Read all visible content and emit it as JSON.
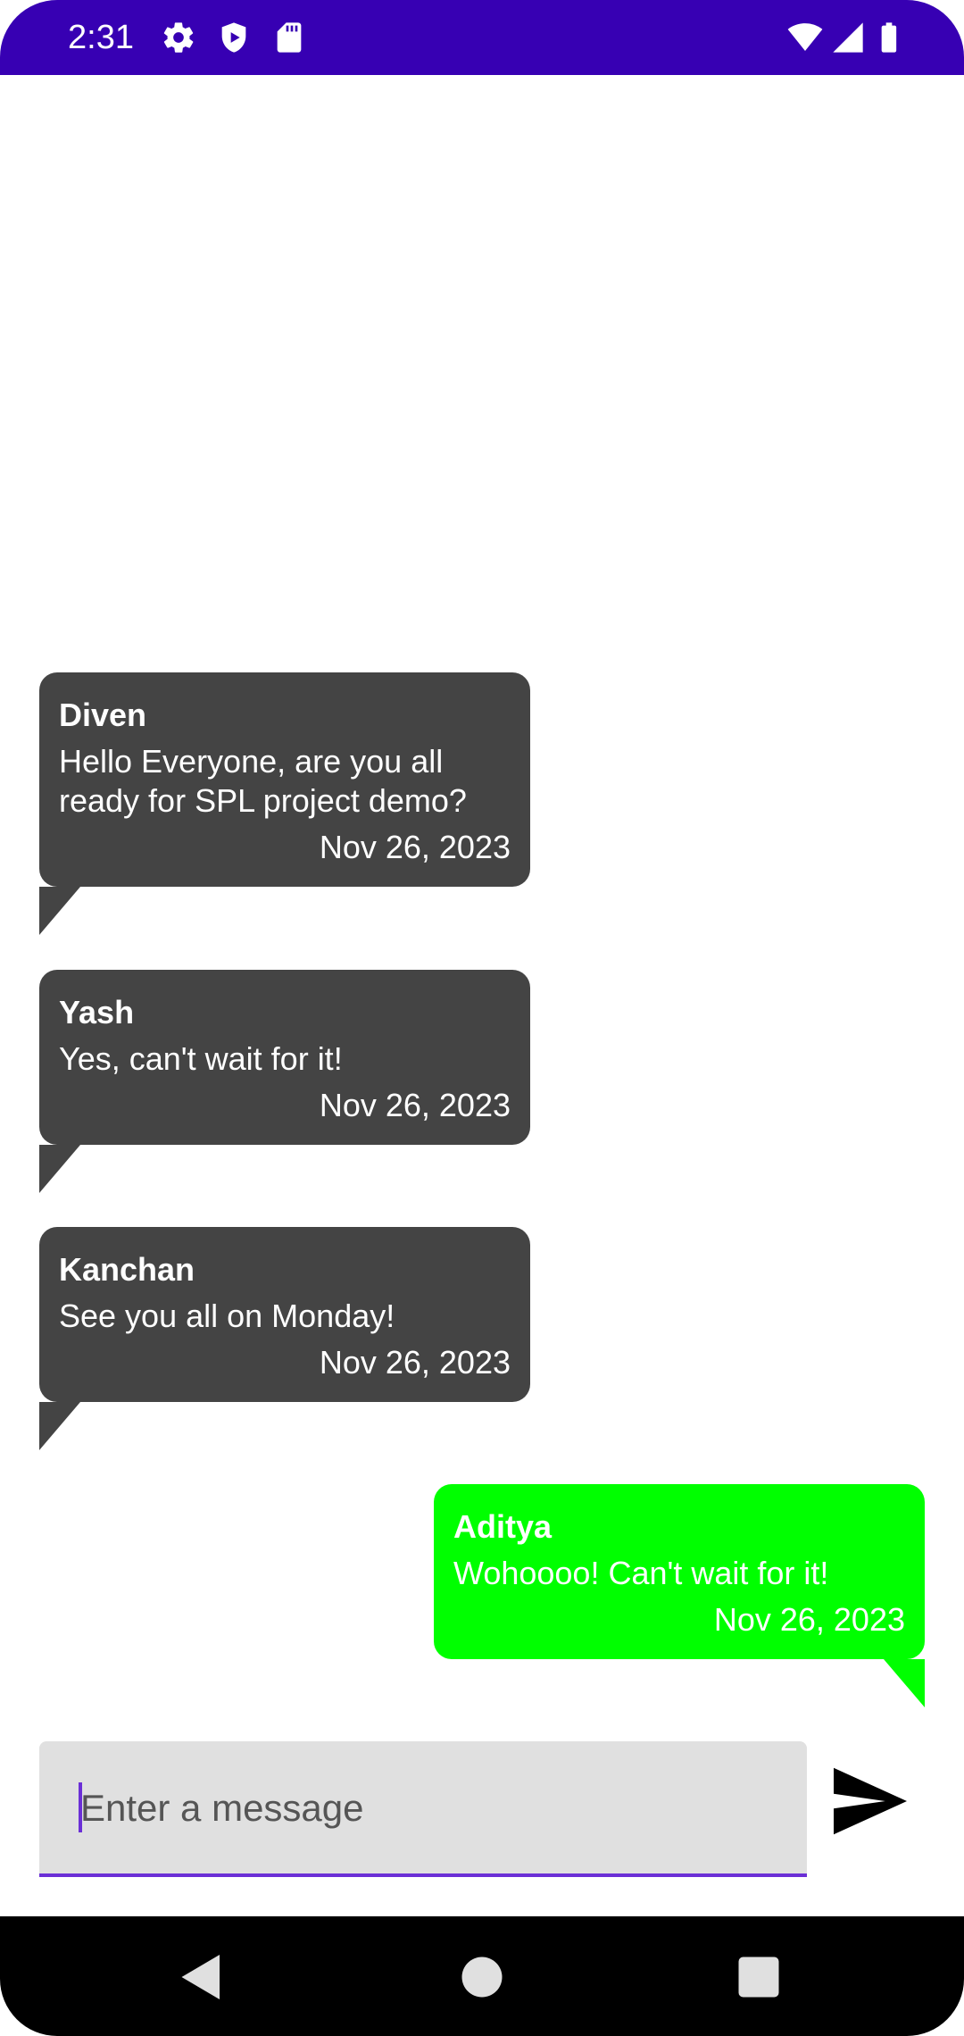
{
  "status_bar": {
    "time": "2:31",
    "left_icons": [
      "settings-icon",
      "shield-play-icon",
      "sd-card-icon"
    ],
    "right_icons": [
      "wifi-icon",
      "signal-icon",
      "battery-icon"
    ],
    "background": "#3700b3"
  },
  "messages": [
    {
      "sender": "Diven",
      "text": "Hello Everyone, are you all ready for SPL project demo?",
      "date": "Nov 26, 2023",
      "direction": "incoming"
    },
    {
      "sender": "Yash",
      "text": "Yes, can't wait for it!",
      "date": "Nov 26, 2023",
      "direction": "incoming"
    },
    {
      "sender": "Kanchan",
      "text": "See you all on Monday!",
      "date": "Nov 26, 2023",
      "direction": "incoming"
    },
    {
      "sender": "Aditya",
      "text": "Wohoooo! Can't wait for it!",
      "date": "Nov 26, 2023",
      "direction": "outgoing"
    }
  ],
  "colors": {
    "incoming_bubble": "#444444",
    "outgoing_bubble": "#00ff00",
    "accent": "#6b2fd6"
  },
  "composer": {
    "placeholder": "Enter a message",
    "value": "",
    "send_icon": "send-icon"
  },
  "nav_bar": {
    "buttons": [
      "back-icon",
      "home-icon",
      "recents-icon"
    ]
  }
}
